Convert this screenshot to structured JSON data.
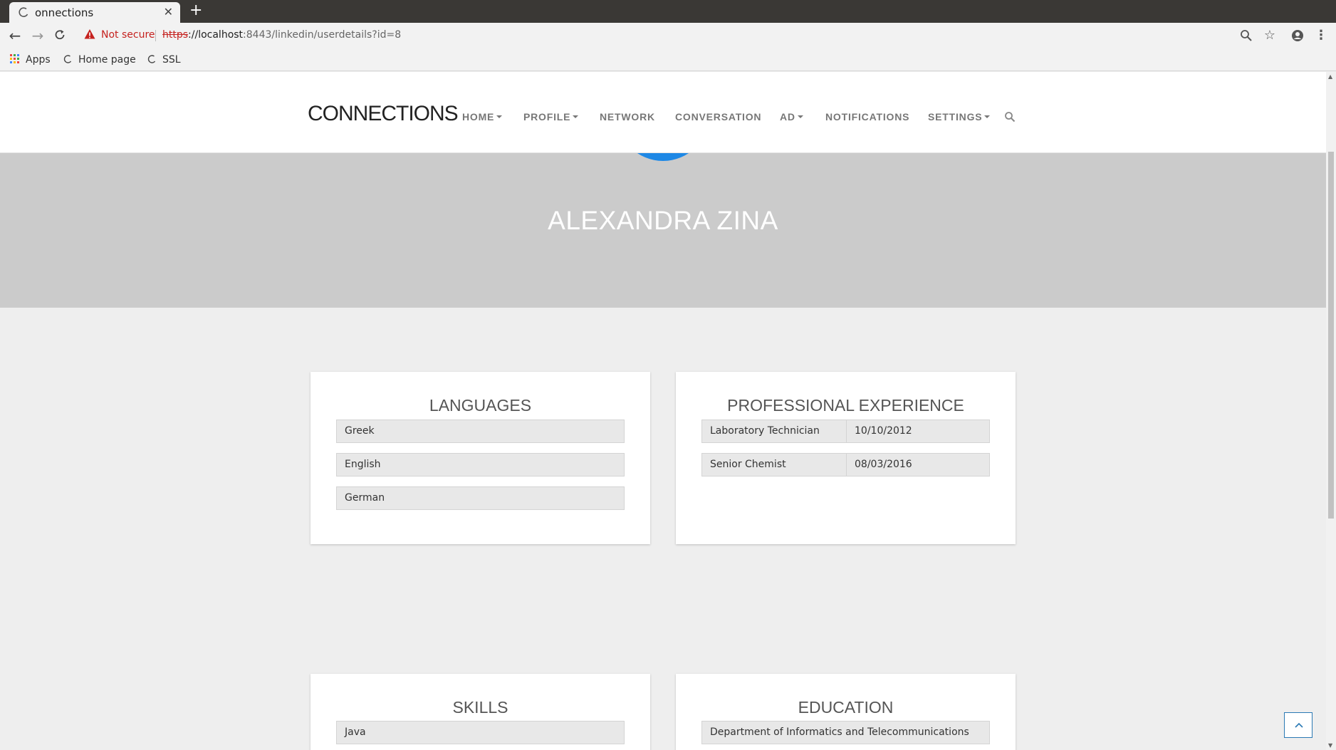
{
  "browser": {
    "tab_title": "onnections",
    "url_scheme": "https",
    "url_host": "://localhost",
    "url_rest": ":8443/linkedin/userdetails?id=8",
    "security_label": "Not secure",
    "bookmarks": [
      "Apps",
      "Home page",
      "SSL"
    ]
  },
  "site": {
    "logo": "CONNECTIONS",
    "nav": [
      "HOME",
      "PROFILE",
      "NETWORK",
      "CONVERSATION",
      "AD",
      "NOTIFICATIONS",
      "SETTINGS"
    ]
  },
  "profile": {
    "name": "ALEXANDRA ZINA"
  },
  "languages": {
    "title": "LANGUAGES",
    "items": [
      "Greek",
      "English",
      "German"
    ]
  },
  "experience": {
    "title": "PROFESSIONAL EXPERIENCE",
    "items": [
      {
        "position": "Laboratory Technician",
        "date": "10/10/2012"
      },
      {
        "position": "Senior Chemist",
        "date": "08/03/2016"
      }
    ]
  },
  "skills": {
    "title": "SKILLS",
    "items": [
      "Java"
    ]
  },
  "education": {
    "title": "EDUCATION",
    "items": [
      "Department of Informatics and Telecommunications"
    ]
  },
  "colors": {
    "hero_bg": "#cbcbcb",
    "page_bg": "#eeeeee",
    "accent": "#2a79b4"
  }
}
